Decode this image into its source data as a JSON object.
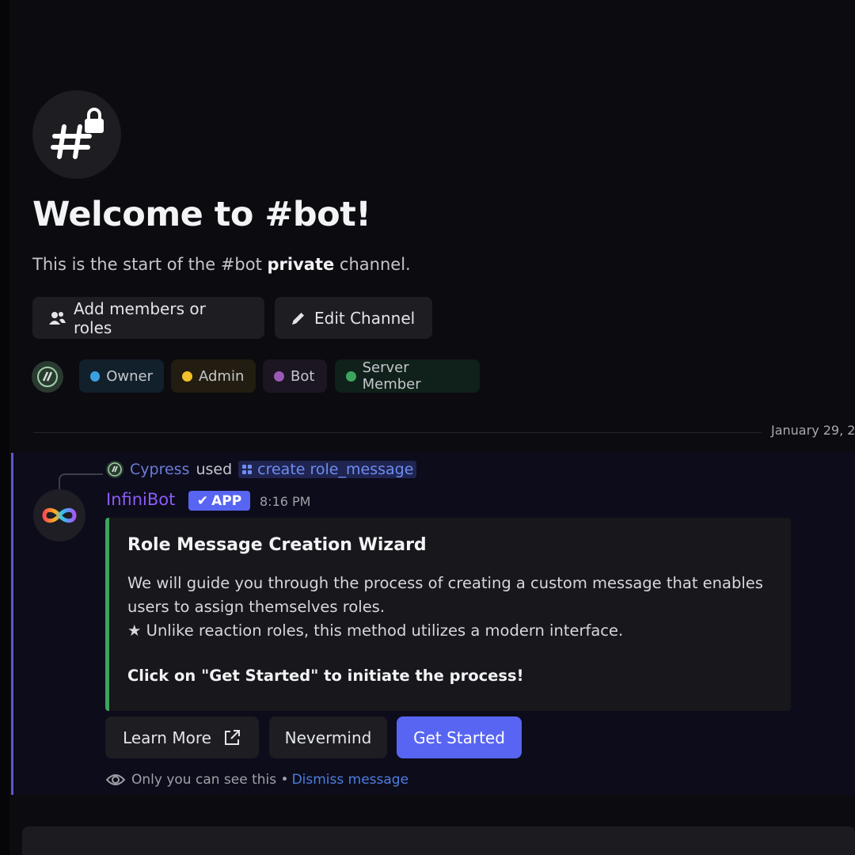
{
  "channel": {
    "icon": "hashtag-lock-icon",
    "welcome_title": "Welcome to #bot!",
    "subtitle_pre": "This is the start of the #bot ",
    "subtitle_bold": "private",
    "subtitle_post": " channel."
  },
  "actions": {
    "add_members_label": "Add members or roles",
    "edit_channel_label": "Edit Channel"
  },
  "roles": [
    {
      "name": "Owner",
      "color": "#3ba0e0",
      "bg": "#12202c"
    },
    {
      "name": "Admin",
      "color": "#f2c02b",
      "bg": "#221d10"
    },
    {
      "name": "Bot",
      "color": "#9b59b6",
      "bg": "#1c1522"
    },
    {
      "name": "Server Member",
      "color": "#3ba55c",
      "bg": "#10201a"
    }
  ],
  "date_divider": "January 29, 2",
  "message": {
    "reply_user": "Cypress",
    "reply_used": "used",
    "reply_command": "create role_message",
    "bot_name": "InfiniBot",
    "badge": "APP",
    "timestamp": "8:16 PM",
    "embed": {
      "accent": "#3ba55c",
      "title": "Role Message Creation Wizard",
      "line1": "We will guide you through the process of creating a custom message that enables",
      "line2": "users to assign themselves roles.",
      "line3": "★ Unlike reaction roles, this method utilizes a modern interface.",
      "cta": "Click on \"Get Started\" to initiate the process!"
    },
    "buttons": {
      "learn_more": "Learn More",
      "nevermind": "Nevermind",
      "get_started": "Get Started"
    },
    "ephemeral_text": "Only you can see this •",
    "dismiss_text": "Dismiss message"
  }
}
